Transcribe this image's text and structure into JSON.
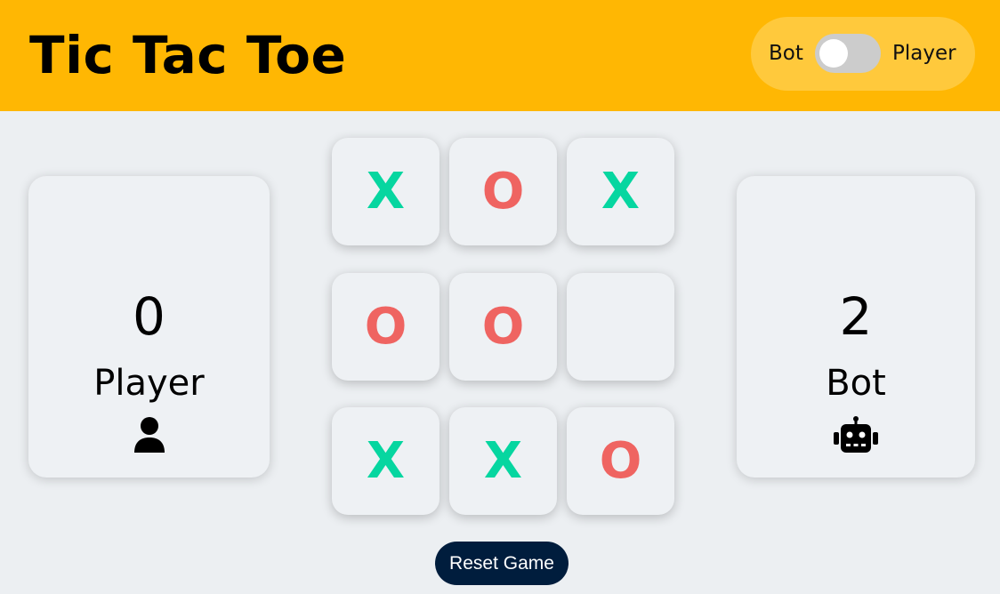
{
  "header": {
    "title": "Tic Tac Toe",
    "toggle": {
      "left_label": "Bot",
      "right_label": "Player",
      "state": "off"
    }
  },
  "scores": {
    "player": {
      "score": "0",
      "name": "Player",
      "icon": "user-icon"
    },
    "bot": {
      "score": "2",
      "name": "Bot",
      "icon": "robot-icon"
    }
  },
  "board": {
    "cells": [
      "X",
      "O",
      "X",
      "O",
      "O",
      "",
      "X",
      "X",
      "O"
    ]
  },
  "reset_label": "Reset Game",
  "colors": {
    "header": "#ffb703",
    "toggle_bg": "#ffc93c",
    "x": "#06d6a0",
    "o": "#ef6461",
    "reset_bg": "#001d3d",
    "page_bg": "#eceff2"
  }
}
